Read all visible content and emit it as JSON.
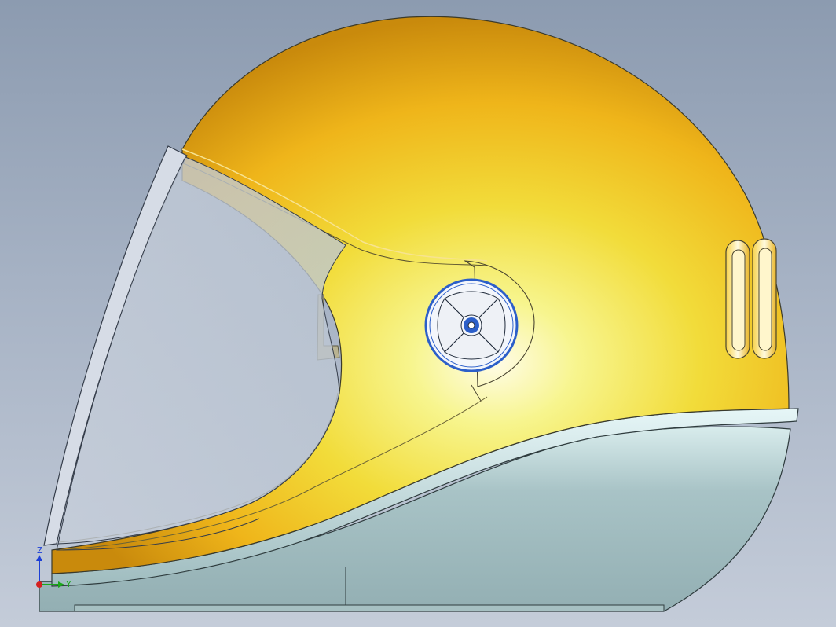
{
  "viewport": {
    "background_top": "#8c9bb0",
    "background_bottom": "#c4ccd9"
  },
  "model": {
    "shell_color": "#f2c21c",
    "shell_highlight": "#fbfba0",
    "chin_guard_color": "#a9c4c7",
    "visor_color": "#c3ccd8",
    "pivot_color": "#2c5fc9",
    "edge_color": "#3b3a2a"
  },
  "triad": {
    "z_label": "Z",
    "y_label": "Y",
    "z_color": "#1d3fd6",
    "y_color": "#1aa81a",
    "x_color": "#d42020"
  }
}
